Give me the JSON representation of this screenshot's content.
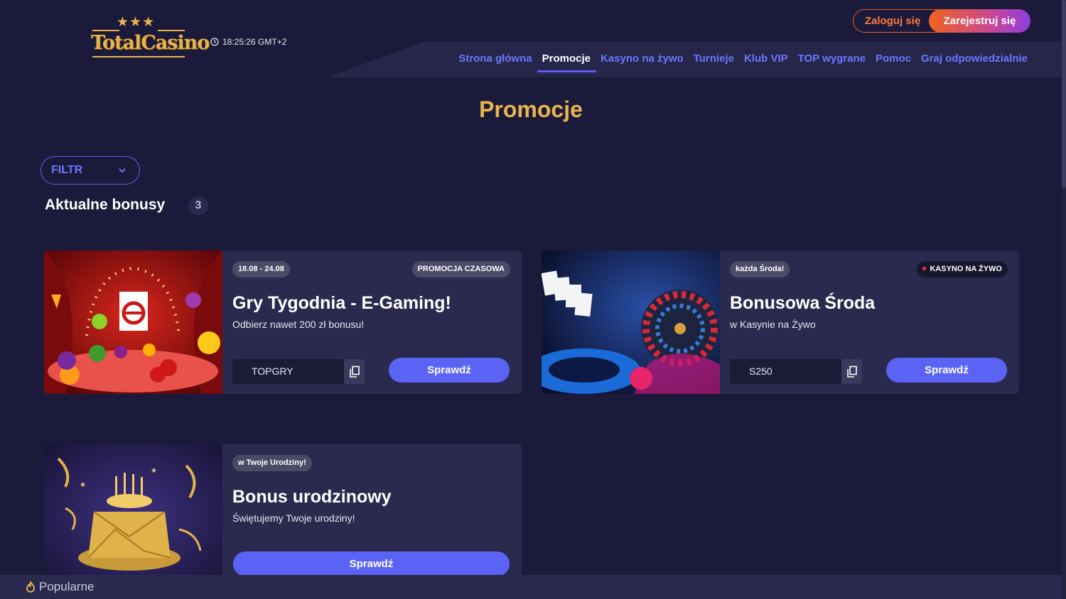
{
  "header": {
    "brand": "TotalCasino",
    "time": "18:25:26 GMT+2",
    "nav": [
      {
        "label": "Strona główna"
      },
      {
        "label": "Promocje"
      },
      {
        "label": "Kasyno na żywo"
      },
      {
        "label": "Turnieje"
      },
      {
        "label": "Klub VIP"
      },
      {
        "label": "TOP wygrane"
      },
      {
        "label": "Pomoc"
      },
      {
        "label": "Graj odpowiedzialnie"
      }
    ],
    "active_nav": "Promocje",
    "login_label": "Zaloguj się",
    "register_label": "Zarejestruj się"
  },
  "page_title": "Promocje",
  "filter_label": "FILTR",
  "section": {
    "title": "Aktualne bonusy",
    "count": "3"
  },
  "cards": [
    {
      "tag_left": "18.08 - 24.08",
      "tag_right": "PROMOCJA CZASOWA",
      "title": "Gry Tygodnia - E-Gaming!",
      "subtitle": "Odbierz nawet 200 zł bonusu!",
      "code": "TOPGRY",
      "button": "Sprawdź"
    },
    {
      "tag_left": "każda Środa!",
      "tag_right": "KASYNO NA ŻYWO",
      "title": "Bonusowa Środa",
      "subtitle": "w Kasynie na Żywo",
      "code": "S250",
      "button": "Sprawdź"
    },
    {
      "tag_left": "w Twoje Urodziny!",
      "title": "Bonus urodzinowy",
      "subtitle": "Świętujemy Twoje urodziny!",
      "button": "Sprawdź"
    }
  ],
  "bottom_bar": {
    "label": "Popularne"
  },
  "colors": {
    "background": "#1b1a3a",
    "accent_gold": "#e9b44c",
    "nav_blue": "#6a77ff",
    "button_blue": "#5b63f5",
    "orange": "#f0621e",
    "purple": "#8a3ee0"
  },
  "icons": [
    "clock-icon",
    "chevron-down-icon",
    "copy-icon",
    "flame-icon",
    "live-dot-icon"
  ]
}
